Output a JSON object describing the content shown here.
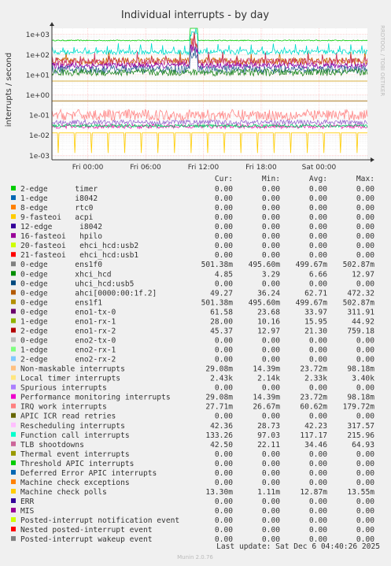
{
  "chart_data": {
    "type": "line",
    "title": "Individual interrupts - by day",
    "ylabel": "interrupts / second",
    "y_scale": "log",
    "ylim": [
      0.0006,
      2000
    ],
    "y_ticks": [
      {
        "v": 1000,
        "label": "1e+03"
      },
      {
        "v": 100,
        "label": "1e+02"
      },
      {
        "v": 10,
        "label": "1e+01"
      },
      {
        "v": 1,
        "label": "1e+00"
      },
      {
        "v": 0.1,
        "label": "1e-01"
      },
      {
        "v": 0.01,
        "label": "1e-02"
      },
      {
        "v": 0.001,
        "label": "1e-03"
      }
    ],
    "x_ticks": [
      {
        "pos": 0.142,
        "label": "Fri 00:00"
      },
      {
        "pos": 0.371,
        "label": "Fri 06:00"
      },
      {
        "pos": 0.6,
        "label": "Fri 12:00"
      },
      {
        "pos": 0.829,
        "label": "Fri 18:00"
      },
      {
        "pos": 1.058,
        "label": "Sat 00:00"
      }
    ],
    "x_pos_domain": [
      0,
      1.25
    ],
    "grid": true,
    "watermark": "RRDTOOL / TOBI OETIKER",
    "series_traces": [
      {
        "level": 500,
        "color": "#00cc00",
        "noise": 0.05,
        "period": 0
      },
      {
        "level": 48,
        "color": "#cc6600",
        "noise": 0.35,
        "period": 18
      },
      {
        "level": 133,
        "color": "#00ddcc",
        "noise": 0.25,
        "period": 14
      },
      {
        "level": 42,
        "color": "#cc3366",
        "noise": 0.4,
        "period": 18
      },
      {
        "level": 28,
        "color": "#8800aa",
        "noise": 0.3,
        "period": 0
      },
      {
        "level": 18,
        "color": "#336699",
        "noise": 0.4,
        "period": 0
      },
      {
        "level": 13,
        "color": "#228822",
        "noise": 0.35,
        "period": 0
      },
      {
        "level": 4.85,
        "color": "#cc9900",
        "noise": 0.0,
        "period": 0
      },
      {
        "level": 0.5,
        "color": "#996600",
        "noise": 0.0,
        "period": 0
      },
      {
        "level": 0.1,
        "color": "#ff8888",
        "noise": 0.55,
        "period": 0
      },
      {
        "level": 0.043,
        "color": "#9966cc",
        "noise": 0.25,
        "period": 0
      },
      {
        "level": 0.027,
        "color": "#ee22aa",
        "noise": 0.2,
        "period": 0
      },
      {
        "level": 0.029,
        "color": "#00cc66",
        "noise": 0.15,
        "period": 0
      },
      {
        "level": 0.013,
        "color": "#ffcc00",
        "noise": 0.0,
        "period": 14
      }
    ],
    "spike_x": 0.45,
    "headers": [
      "Cur:",
      "Min:",
      "Avg:",
      "Max:"
    ],
    "legend": [
      {
        "name": "2-edge      timer",
        "color": "#00cc00",
        "cur": "0.00",
        "min": "0.00",
        "avg": "0.00",
        "max": "0.00"
      },
      {
        "name": "1-edge      i8042",
        "color": "#0066b3",
        "cur": "0.00",
        "min": "0.00",
        "avg": "0.00",
        "max": "0.00"
      },
      {
        "name": "8-edge      rtc0",
        "color": "#ff8000",
        "cur": "0.00",
        "min": "0.00",
        "avg": "0.00",
        "max": "0.00"
      },
      {
        "name": "9-fasteoi   acpi",
        "color": "#ffcc00",
        "cur": "0.00",
        "min": "0.00",
        "avg": "0.00",
        "max": "0.00"
      },
      {
        "name": "12-edge      i8042",
        "color": "#330099",
        "cur": "0.00",
        "min": "0.00",
        "avg": "0.00",
        "max": "0.00"
      },
      {
        "name": "16-fasteoi   hpilo",
        "color": "#990099",
        "cur": "0.00",
        "min": "0.00",
        "avg": "0.00",
        "max": "0.00"
      },
      {
        "name": "20-fasteoi   ehci_hcd:usb2",
        "color": "#ccff00",
        "cur": "0.00",
        "min": "0.00",
        "avg": "0.00",
        "max": "0.00"
      },
      {
        "name": "21-fasteoi   ehci_hcd:usb1",
        "color": "#ff0000",
        "cur": "0.00",
        "min": "0.00",
        "avg": "0.00",
        "max": "0.00"
      },
      {
        "name": "0-edge      ens1f0",
        "color": "#808080",
        "cur": "501.38m",
        "min": "495.60m",
        "avg": "499.67m",
        "max": "502.87m"
      },
      {
        "name": "0-edge      xhci_hcd",
        "color": "#008f00",
        "cur": "4.85",
        "min": "3.29",
        "avg": "6.66",
        "max": "12.97"
      },
      {
        "name": "0-edge      uhci_hcd:usb5",
        "color": "#00487d",
        "cur": "0.00",
        "min": "0.00",
        "avg": "0.00",
        "max": "0.00"
      },
      {
        "name": "0-edge      ahci[0000:00:1f.2]",
        "color": "#b35a00",
        "cur": "49.27",
        "min": "36.24",
        "avg": "62.71",
        "max": "472.32"
      },
      {
        "name": "0-edge      ens1f1",
        "color": "#b38f00",
        "cur": "501.38m",
        "min": "495.60m",
        "avg": "499.67m",
        "max": "502.87m"
      },
      {
        "name": "0-edge      eno1-tx-0",
        "color": "#6b006b",
        "cur": "61.58",
        "min": "23.68",
        "avg": "33.97",
        "max": "311.91"
      },
      {
        "name": "1-edge      eno1-rx-1",
        "color": "#8fb300",
        "cur": "28.00",
        "min": "10.16",
        "avg": "15.95",
        "max": "44.92"
      },
      {
        "name": "2-edge      eno1-rx-2",
        "color": "#b30000",
        "cur": "45.37",
        "min": "12.97",
        "avg": "21.30",
        "max": "759.18"
      },
      {
        "name": "0-edge      eno2-tx-0",
        "color": "#bebebe",
        "cur": "0.00",
        "min": "0.00",
        "avg": "0.00",
        "max": "0.00"
      },
      {
        "name": "1-edge      eno2-rx-1",
        "color": "#80ff80",
        "cur": "0.00",
        "min": "0.00",
        "avg": "0.00",
        "max": "0.00"
      },
      {
        "name": "2-edge      eno2-rx-2",
        "color": "#80c9ff",
        "cur": "0.00",
        "min": "0.00",
        "avg": "0.00",
        "max": "0.00"
      },
      {
        "name": "Non-maskable interrupts",
        "color": "#ffc080",
        "cur": "29.08m",
        "min": "14.39m",
        "avg": "23.72m",
        "max": "98.18m"
      },
      {
        "name": "Local timer interrupts",
        "color": "#ffe680",
        "cur": "2.43k",
        "min": "2.14k",
        "avg": "2.33k",
        "max": "3.40k"
      },
      {
        "name": "Spurious interrupts",
        "color": "#aa80ff",
        "cur": "0.00",
        "min": "0.00",
        "avg": "0.00",
        "max": "0.00"
      },
      {
        "name": "Performance monitoring interrupts",
        "color": "#ee00cc",
        "cur": "29.08m",
        "min": "14.39m",
        "avg": "23.72m",
        "max": "98.18m"
      },
      {
        "name": "IRQ work interrupts",
        "color": "#ff8080",
        "cur": "27.71m",
        "min": "26.67m",
        "avg": "60.62m",
        "max": "179.72m"
      },
      {
        "name": "APIC ICR read retries",
        "color": "#666600",
        "cur": "0.00",
        "min": "0.00",
        "avg": "0.00",
        "max": "0.00"
      },
      {
        "name": "Rescheduling interrupts",
        "color": "#ffbfff",
        "cur": "42.36",
        "min": "28.73",
        "avg": "42.23",
        "max": "317.57"
      },
      {
        "name": "Function call interrupts",
        "color": "#00ffcc",
        "cur": "133.26",
        "min": "97.03",
        "avg": "117.17",
        "max": "215.96"
      },
      {
        "name": "TLB shootdowns",
        "color": "#cc6699",
        "cur": "42.50",
        "min": "22.11",
        "avg": "34.46",
        "max": "64.93"
      },
      {
        "name": "Thermal event interrupts",
        "color": "#999900",
        "cur": "0.00",
        "min": "0.00",
        "avg": "0.00",
        "max": "0.00"
      },
      {
        "name": "Threshold APIC interrupts",
        "color": "#00cc00",
        "cur": "0.00",
        "min": "0.00",
        "avg": "0.00",
        "max": "0.00"
      },
      {
        "name": "Deferred Error APIC interrupts",
        "color": "#0066b3",
        "cur": "0.00",
        "min": "0.00",
        "avg": "0.00",
        "max": "0.00"
      },
      {
        "name": "Machine check exceptions",
        "color": "#ff8000",
        "cur": "0.00",
        "min": "0.00",
        "avg": "0.00",
        "max": "0.00"
      },
      {
        "name": "Machine check polls",
        "color": "#ffcc00",
        "cur": "13.30m",
        "min": "1.11m",
        "avg": "12.87m",
        "max": "13.55m"
      },
      {
        "name": "ERR",
        "color": "#330099",
        "cur": "0.00",
        "min": "0.00",
        "avg": "0.00",
        "max": "0.00"
      },
      {
        "name": "MIS",
        "color": "#990099",
        "cur": "0.00",
        "min": "0.00",
        "avg": "0.00",
        "max": "0.00"
      },
      {
        "name": "Posted-interrupt notification event",
        "color": "#ccff00",
        "cur": "0.00",
        "min": "0.00",
        "avg": "0.00",
        "max": "0.00"
      },
      {
        "name": "Nested posted-interrupt event",
        "color": "#ff0000",
        "cur": "0.00",
        "min": "0.00",
        "avg": "0.00",
        "max": "0.00"
      },
      {
        "name": "Posted-interrupt wakeup event",
        "color": "#808080",
        "cur": "0.00",
        "min": "0.00",
        "avg": "0.00",
        "max": "0.00"
      }
    ],
    "last_update": "Last update: Sat Dec  6 04:40:26 2025",
    "footer": "Munin 2.0.76"
  }
}
